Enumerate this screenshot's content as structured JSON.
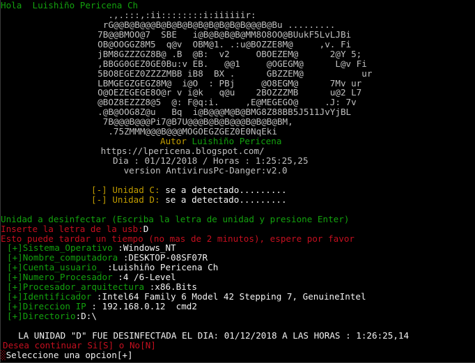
{
  "header": {
    "greeting": "Hola  Luishiño Pericena Ch"
  },
  "ascii_art": [
    "    .,.:::,:ii::::::::i:iiiiiir:",
    "   rG@@B@B@@@B@B@B@B@B@B@B@B@B@@@B@Bu .........",
    "  7B@@BMOO@7  SBE   i@B@B@B@B@MM8O8OO@BUukF5LvLJBi",
    "  OB@OOGGZ8M5  q@v  OBM@1. .:u@BOZZE8M@     ,v. Fi",
    "  jBM8GZZZGZ8B@ .B  @B:  v2     OBOEZEM@      2@Y 5;",
    "  ,BBGG0GEZ0GE0Bu:v EB.   @@1     @OGEGM@      L@v Fi",
    "  5BO8EGEZ0ZZZZMBB iB8  BX .      GBZZEM@           ur",
    "  LBMGEGZGEGZ8M@  i@O  : PBj     @O8EGM@      7Mv ur",
    "  O@OEZEGEGE8O@r v i@k   q@u    2BOZZZMB      u@2 L7",
    "  @BOZ8EZZZ8@5  @: F@q:i.     ,E@MEGEGO@     .J: 7v",
    "  .@B@OOG8Z@u   Bq  i@B@@@M@B@BMG8Z88BB5J511JvYjBL",
    "   7B@@@B@@@Pi7@B7U@@@B@B@B@@@B@B@B@BM,",
    "    .75ZMMM@@@B@@@MOGOEGZGEZ0E0NqEki"
  ],
  "banner": {
    "author_label": "Autor",
    "author_name": "Luishiño Pericena",
    "url_line": " https://lpericena.blogspot.com/ ",
    "date_line": "Dia : 01/12/2018 / Horas : 1:25:25,25",
    "version_line": " version AntivirusPc-Danger:v2.0"
  },
  "drives": [
    {
      "bracket": "[-]",
      "label": "Unidad C:",
      "status": "se a detectado........."
    },
    {
      "bracket": "[-]",
      "label": "Unidad D:",
      "status": "se a detectado........."
    }
  ],
  "prompt": {
    "instruction": "Unidad a desinfectar (Escriba la letra de unidad y presione Enter)",
    "input_label": "Inserte la letra de la usb:",
    "input_value": "D",
    "wait_notice": "Esto puede tardar un tiempo (no mas de 2 minutos), espere por favor"
  },
  "system_info": [
    {
      "tag": "[+]",
      "key": "Sistema_Operativo",
      "value": " :Windows_NT"
    },
    {
      "tag": "[+]",
      "key": "Nombre_computadora",
      "value": " :DESKTOP-08SF07R"
    },
    {
      "tag": "[+]",
      "key": "Cuenta_usuario_",
      "value": " :Luishiño Pericena Ch"
    },
    {
      "tag": "[+]",
      "key": "Numero_Procesador",
      "value": " :4 /6-Level"
    },
    {
      "tag": "[+]",
      "key": "Procesador_arquitectura",
      "value": " :x86.Bits"
    },
    {
      "tag": "[+]",
      "key": "Identificador",
      "value": " :Intel64 Family 6 Model 42 Stepping 7, GenuineIntel"
    },
    {
      "tag": "[+]",
      "key": "Direccion IP",
      "value": " : 192.168.0.12  cmd2"
    },
    {
      "tag": "[+]",
      "key": "Directorio",
      "value": ":D:\\"
    }
  ],
  "result": {
    "message": "LA UNIDAD \"D\" FUE DESINFECTADA EL DIA: 01/12/2018 A LAS HORAS : 1:26:25,14",
    "continue_prompt": "Desea continuar Si[S] o No[N]",
    "select_prompt": "Seleccione una opcion[+]"
  },
  "colors": {
    "background": "#000000",
    "text_gray": "#c0c0c0",
    "green": "#13a10e",
    "red": "#c50f1f",
    "yellow": "#c19c00"
  }
}
